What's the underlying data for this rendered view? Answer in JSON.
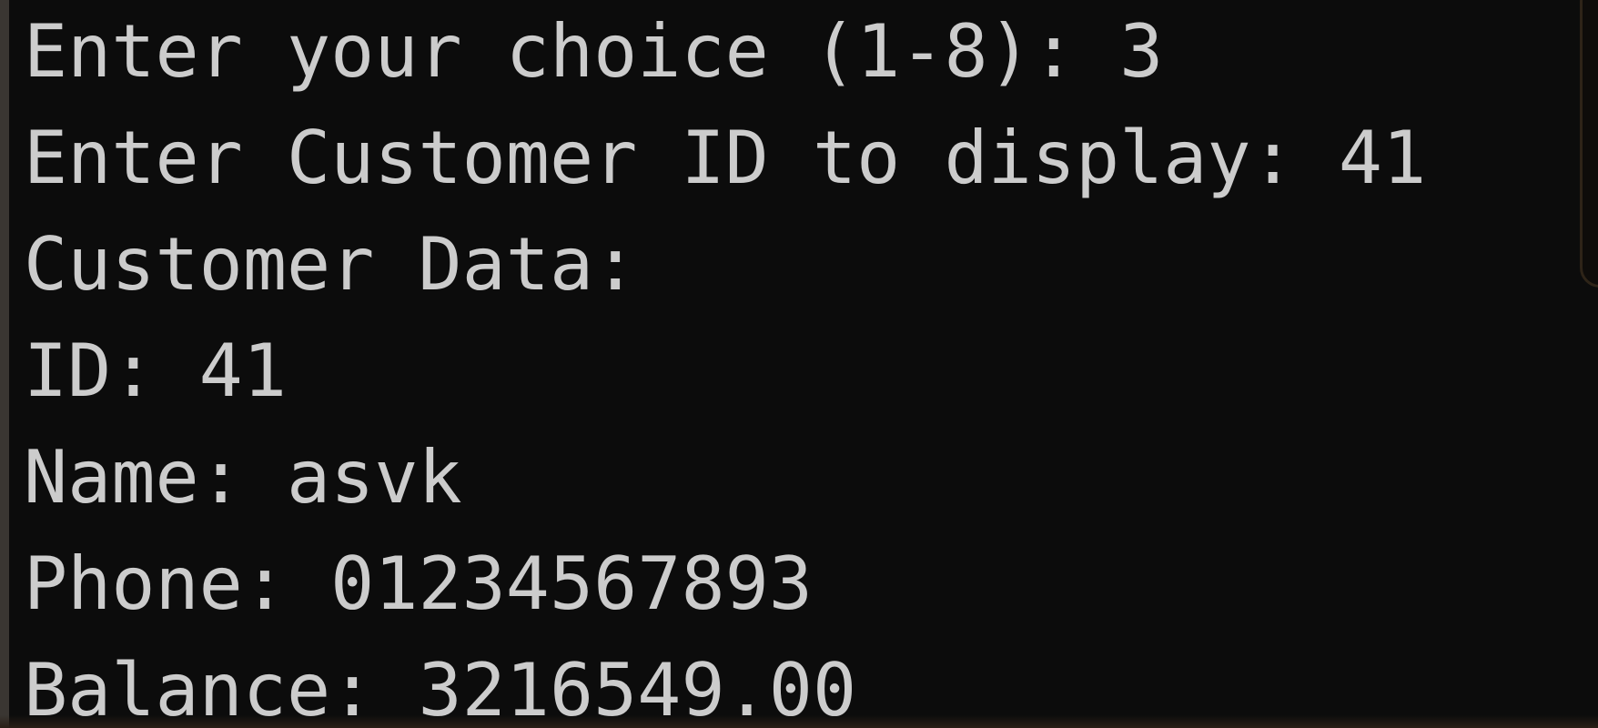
{
  "console": {
    "lines": [
      "Enter your choice (1-8): 3",
      "Enter Customer ID to display: 41",
      "Customer Data:",
      "ID: 41",
      "Name: asvk",
      "Phone: 01234567893",
      "Balance: 3216549.00"
    ]
  },
  "colors": {
    "background": "#0c0c0c",
    "text": "#cccccc"
  }
}
